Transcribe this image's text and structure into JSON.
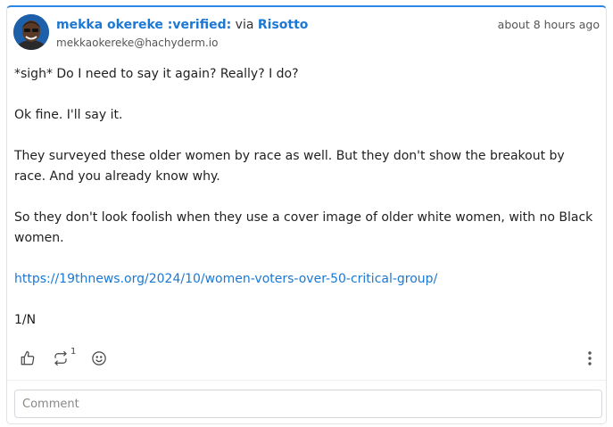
{
  "post": {
    "author_name": "mekka okereke :verified:",
    "via_text": "via",
    "app_name": "Risotto",
    "handle": "mekkaokereke@hachyderm.io",
    "timestamp": "about 8 hours ago",
    "paragraphs": [
      "*sigh* Do I need to say it again? Really? I do?",
      "Ok fine. I'll say it.",
      "They surveyed these older women by race as well. But they don't show the breakout by race. And you already know why.",
      "So they don't look foolish when they use a cover image of older white women, with no Black women."
    ],
    "link": "https://19thnews.org/2024/10/women-voters-over-50-critical-group/",
    "footer_text": "1/N"
  },
  "actions": {
    "like_icon": "thumbs-up-icon",
    "boost_icon": "repeat-icon",
    "boost_count": "1",
    "react_icon": "smiley-icon",
    "more_icon": "more-vertical-icon"
  },
  "comment": {
    "placeholder": "Comment"
  },
  "colors": {
    "accent": "#1c78d4",
    "top_border": "#2b86e6"
  }
}
